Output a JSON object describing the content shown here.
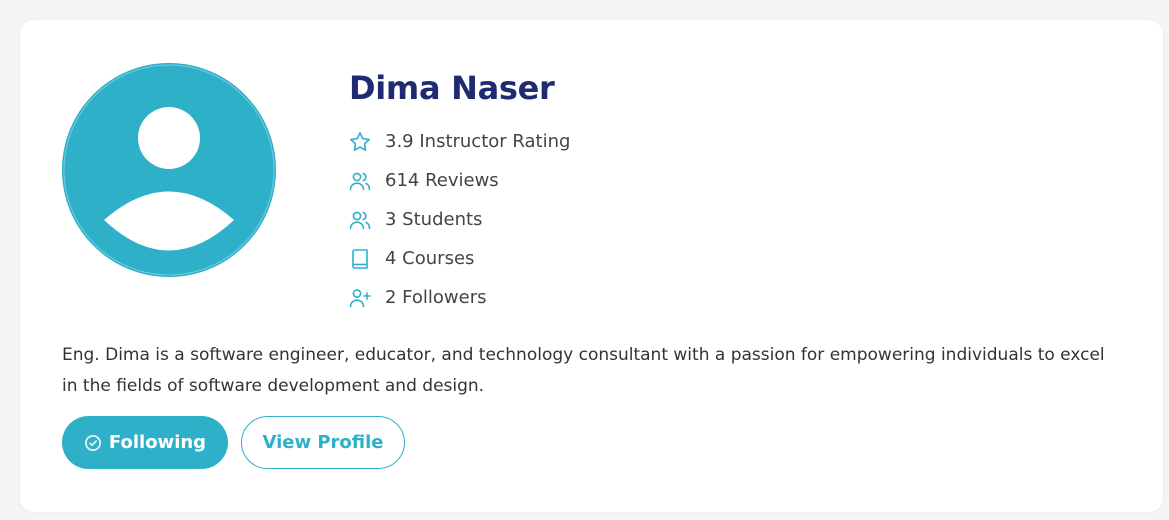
{
  "colors": {
    "accent": "#2eb0c9",
    "name": "#1e2b72"
  },
  "profile": {
    "name": "Dima Naser",
    "avatar_icon": "user-avatar-icon"
  },
  "stats": [
    {
      "icon": "star-icon",
      "label": "3.9 Instructor Rating"
    },
    {
      "icon": "users-icon",
      "label": "614 Reviews"
    },
    {
      "icon": "users-icon",
      "label": "3 Students"
    },
    {
      "icon": "book-icon",
      "label": "4 Courses"
    },
    {
      "icon": "user-plus-icon",
      "label": "2 Followers"
    }
  ],
  "bio": "Eng. Dima is a software engineer, educator, and technology consultant with a passion for empowering individuals to excel in the fields of software development and design.",
  "actions": {
    "following_label": "Following",
    "following_icon": "check-circle-icon",
    "view_profile_label": "View Profile"
  }
}
